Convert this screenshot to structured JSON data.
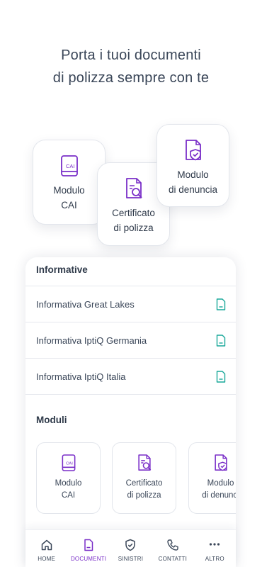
{
  "headline": {
    "line1": "Porta i tuoi documenti",
    "line2": "di polizza sempre con te"
  },
  "floating_cards": [
    {
      "line1": "Modulo",
      "line2": "CAI",
      "icon": "cai-document-icon",
      "badge": "CAI"
    },
    {
      "line1": "Certificato",
      "line2": "di polizza",
      "icon": "certificate-search-icon"
    },
    {
      "line1": "Modulo",
      "line2": "di denuncia",
      "icon": "shield-document-icon"
    }
  ],
  "informative": {
    "title": "Informative",
    "items": [
      {
        "label": "Informativa Great Lakes",
        "icon": "document-icon"
      },
      {
        "label": "Informativa IptiQ Germania",
        "icon": "document-icon"
      },
      {
        "label": "Informativa IptiQ Italia",
        "icon": "document-icon"
      }
    ]
  },
  "moduli": {
    "title": "Moduli",
    "cards": [
      {
        "line1": "Modulo",
        "line2": "CAI",
        "icon": "cai-document-icon",
        "badge": "CAI"
      },
      {
        "line1": "Certificato",
        "line2": "di polizza",
        "icon": "certificate-search-icon"
      },
      {
        "line1": "Modulo",
        "line2": "di denunci",
        "icon": "shield-document-icon"
      }
    ]
  },
  "tabbar": {
    "items": [
      {
        "label": "HOME",
        "icon": "home-icon",
        "active": false
      },
      {
        "label": "DOCUMENTI",
        "icon": "document-icon",
        "active": true
      },
      {
        "label": "SINISTRI",
        "icon": "shield-icon",
        "active": false
      },
      {
        "label": "CONTATTI",
        "icon": "phone-icon",
        "active": false
      },
      {
        "label": "ALTRO",
        "icon": "more-dots-icon",
        "active": false
      }
    ]
  },
  "colors": {
    "accent": "#7a2fc8",
    "teal": "#19a89a",
    "text": "#3a4658"
  }
}
